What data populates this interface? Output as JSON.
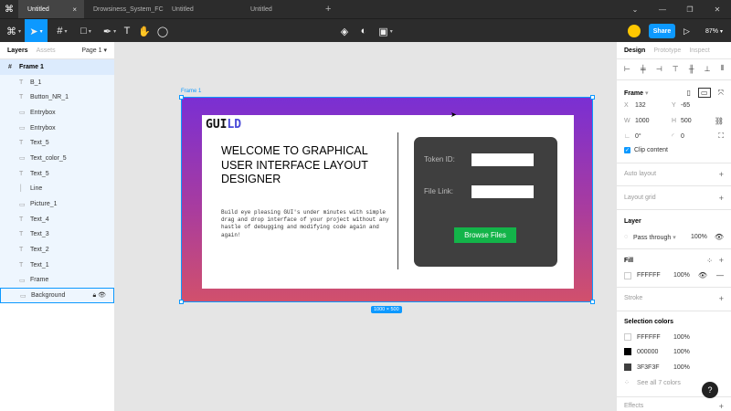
{
  "titlebar": {
    "tabs": [
      "Untitled",
      "Drowsiness_System_FC",
      "Untitled",
      "Untitled"
    ],
    "new_tab": "+"
  },
  "toolbar": {
    "share_label": "Share",
    "zoom": "87%"
  },
  "layers_panel": {
    "tab_layers": "Layers",
    "tab_assets": "Assets",
    "page": "Page 1",
    "items": [
      {
        "name": "Frame 1",
        "icon": "frame-icon"
      },
      {
        "name": "B_1",
        "icon": "text-icon"
      },
      {
        "name": "Button_NR_1",
        "icon": "text-icon"
      },
      {
        "name": "Entrybox",
        "icon": "rect-icon"
      },
      {
        "name": "Entrybox",
        "icon": "rect-icon"
      },
      {
        "name": "Text_5",
        "icon": "text-icon"
      },
      {
        "name": "Text_color_5",
        "icon": "rect-icon"
      },
      {
        "name": "Text_5",
        "icon": "text-icon"
      },
      {
        "name": "Line",
        "icon": "line-icon"
      },
      {
        "name": "Picture_1",
        "icon": "rect-icon"
      },
      {
        "name": "Text_4",
        "icon": "text-icon"
      },
      {
        "name": "Text_3",
        "icon": "text-icon"
      },
      {
        "name": "Text_2",
        "icon": "text-icon"
      },
      {
        "name": "Text_1",
        "icon": "text-icon"
      },
      {
        "name": "Frame",
        "icon": "rect-icon"
      },
      {
        "name": "Background",
        "icon": "rect-icon"
      }
    ]
  },
  "canvas": {
    "frame_label": "Frame 1",
    "size_badge": "1000 × 500",
    "logo_part1": "GUI",
    "logo_part2": "LD",
    "welcome": "WELCOME TO GRAPHICAL USER INTERFACE LAYOUT DESIGNER",
    "description": "Build eye pleasing GUI's under minutes with simple drag and drop interface of your project without any hastle of debugging and modifying code again and again!",
    "token_label": "Token ID:",
    "file_label": "File  Link:",
    "browse_label": "Browse Files",
    "gradient_top": "#7a2fd3",
    "gradient_bottom": "#d1506c",
    "panel_color": "#3f3f3f",
    "button_color": "#13b449"
  },
  "design_panel": {
    "tab_design": "Design",
    "tab_prototype": "Prototype",
    "tab_inspect": "Inspect",
    "frame_title": "Frame",
    "x_label": "X",
    "x_value": "132",
    "y_label": "Y",
    "y_value": "-65",
    "w_label": "W",
    "w_value": "1000",
    "h_label": "H",
    "h_value": "500",
    "rotation": "0°",
    "radius": "0",
    "clip_content": "Clip content",
    "auto_layout": "Auto layout",
    "layout_grid": "Layout grid",
    "layer_title": "Layer",
    "blend_mode": "Pass through",
    "layer_opacity": "100%",
    "fill_title": "Fill",
    "fill_hex": "FFFFFF",
    "fill_opacity": "100%",
    "stroke_title": "Stroke",
    "selection_colors_title": "Selection colors",
    "selection_colors": [
      {
        "hex": "FFFFFF",
        "opacity": "100%",
        "swatch": "#ffffff"
      },
      {
        "hex": "000000",
        "opacity": "100%",
        "swatch": "#000000"
      },
      {
        "hex": "3F3F3F",
        "opacity": "100%",
        "swatch": "#3f3f3f"
      }
    ],
    "see_all": "See all 7 colors",
    "effects_title": "Effects"
  },
  "help": "?"
}
